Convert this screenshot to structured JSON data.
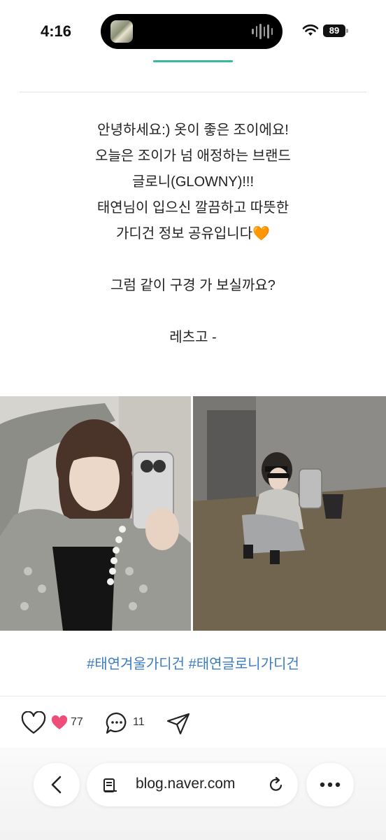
{
  "status_bar": {
    "time": "4:16",
    "battery": "89"
  },
  "post": {
    "lines": [
      "안녕하세요:) 옷이 좋은 조이에요!",
      "오늘은 조이가 넘 애정하는 브랜드",
      "글로니(GLOWNY)!!!",
      "태연님이 입으신 깔끔하고 따뜻한",
      "가디건 정보 공유입니다🧡",
      "그럼 같이 구경 가 보실까요?",
      "레츠고 -"
    ],
    "hashtags": "#태연겨울가디건 #태연글로니가디건"
  },
  "actions": {
    "likes": "77",
    "comments": "11"
  },
  "browser": {
    "url": "blog.naver.com"
  }
}
